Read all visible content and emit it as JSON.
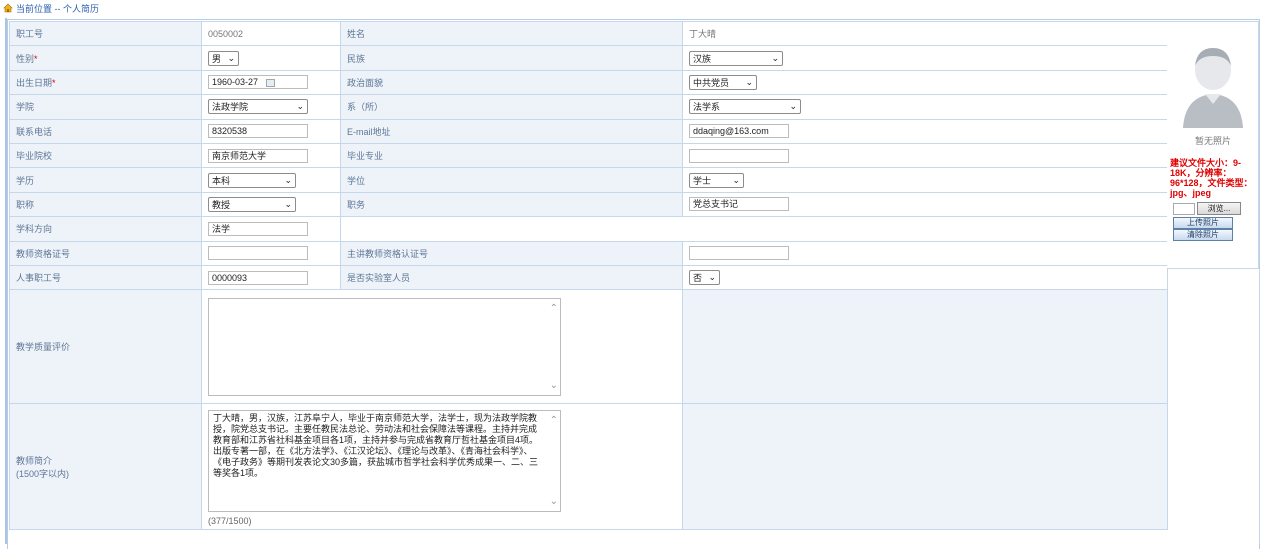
{
  "breadcrumb": {
    "label": "当前位置 -- 个人简历"
  },
  "rows": {
    "staff_no": {
      "label": "职工号",
      "value": "0050002"
    },
    "name": {
      "label": "姓名",
      "value": "丁大晴"
    },
    "gender": {
      "label": "性别",
      "required_mark": "*",
      "selected": "男"
    },
    "ethnicity": {
      "label": "民族",
      "selected": "汉族"
    },
    "birth_date": {
      "label": "出生日期",
      "required_mark": "*",
      "value": "1960-03-27"
    },
    "politics": {
      "label": "政治面貌",
      "selected": "中共党员"
    },
    "college": {
      "label": "学院",
      "selected": "法政学院"
    },
    "department": {
      "label": "系（所）",
      "selected": "法学系"
    },
    "phone": {
      "label": "联系电话",
      "value": "8320538"
    },
    "email": {
      "label": "E-mail地址",
      "value": "ddaqing@163.com"
    },
    "graduated_school": {
      "label": "毕业院校",
      "value": "南京师范大学"
    },
    "graduated_major": {
      "label": "毕业专业",
      "value": ""
    },
    "education": {
      "label": "学历",
      "selected": "本科"
    },
    "degree": {
      "label": "学位",
      "selected": "学士"
    },
    "title": {
      "label": "职称",
      "selected": "教授"
    },
    "position": {
      "label": "职务",
      "value": "党总支书记"
    },
    "discipline": {
      "label": "学科方向",
      "value": "法学"
    },
    "teacher_cert": {
      "label": "教师资格证号",
      "value": ""
    },
    "lecturer_cert": {
      "label": "主讲教师资格认证号",
      "value": ""
    },
    "hr_no": {
      "label": "人事职工号",
      "value": "0000093"
    },
    "lab_staff": {
      "label": "是否实验室人员",
      "selected": "否"
    },
    "teaching_eval": {
      "label": "教学质量评价",
      "value": ""
    },
    "bio": {
      "label": "教师简介",
      "sublabel": "(1500字以内)",
      "value": "丁大晴，男，汉族，江苏阜宁人，毕业于南京师范大学，法学士，现为法政学院教授，院党总支书记。主要任教民法总论、劳动法和社会保障法等课程。主持并完成教育部和江苏省社科基金项目各1项，主持并参与完成省教育厅哲社基金项目4项。出版专著一部，在《北方法学》、《江汉论坛》、《理论与改革》、《青海社会科学》、《电子政务》等期刊发表论文30多篇，获盐城市哲学社会科学优秀成果一、二、三等奖各1项。",
      "counter": "(377/1500)"
    }
  },
  "photo": {
    "no_photo_label": "暂无照片",
    "hint": "建议文件大小：9-18K，分辨率：96*128，文件类型：jpg、jpeg",
    "browse_label": "浏览...",
    "upload_label": "上传照片",
    "clear_label": "清除照片"
  },
  "colors": {
    "label_bg": "#eef3fa",
    "border": "#c7d7ea",
    "accent": "#2a5fb0",
    "hint_red": "#e00000"
  }
}
